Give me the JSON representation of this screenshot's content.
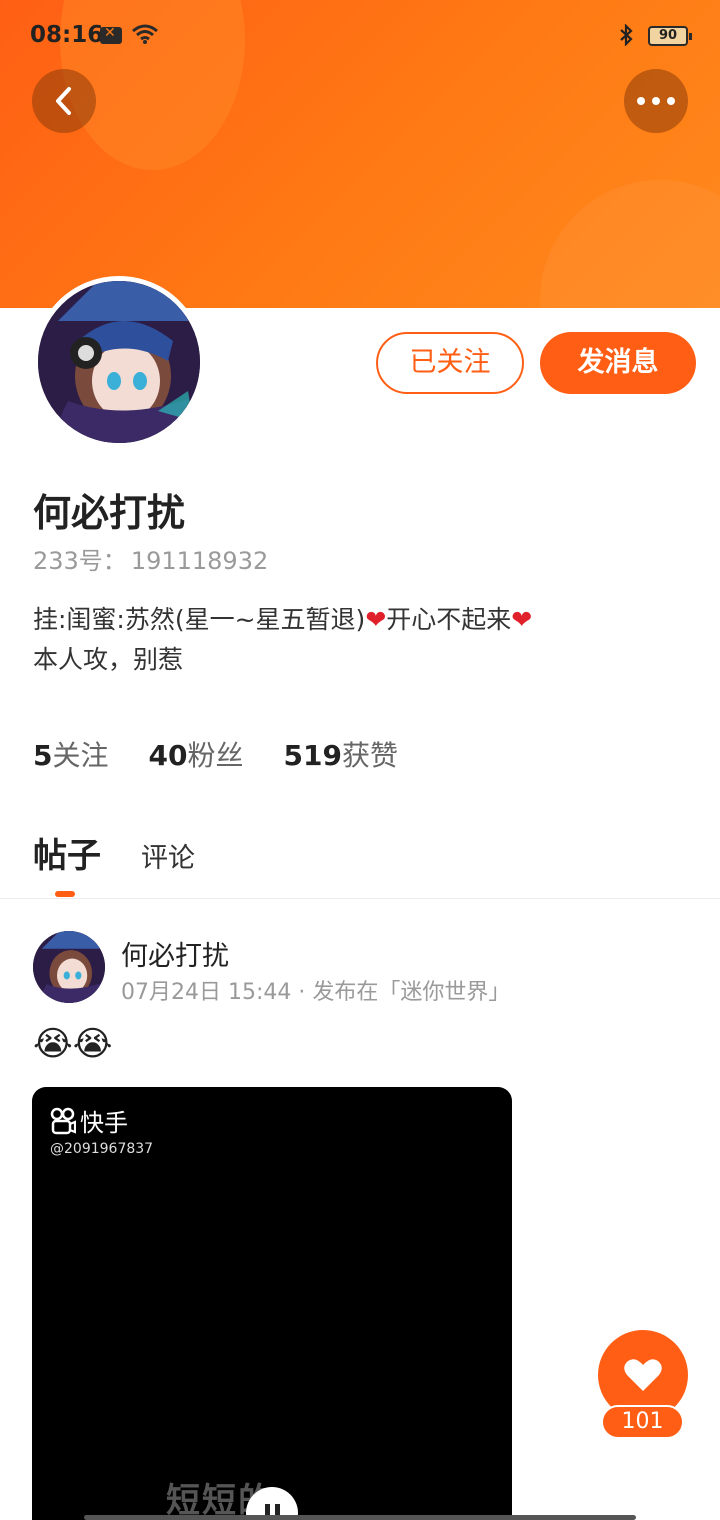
{
  "status_bar": {
    "time": "08:16",
    "battery": "90"
  },
  "header": {
    "gradient_start": "#ff5f14",
    "gradient_end": "#ff8a1e"
  },
  "profile": {
    "follow_button_label": "已关注",
    "message_button_label": "发消息",
    "name": "何必打扰",
    "id_label": "233号：",
    "id_value": "191118932",
    "bio_line1_prefix": "挂:闺蜜:苏然(星一~星五暂退)",
    "bio_heart": "❤",
    "bio_line1_suffix": "开心不起来",
    "bio_line2": "本人攻，别惹"
  },
  "stats": {
    "following_count": "5",
    "following_label": "关注",
    "fans_count": "40",
    "fans_label": "粉丝",
    "likes_count": "519",
    "likes_label": "获赞"
  },
  "tabs": {
    "posts": "帖子",
    "comments": "评论"
  },
  "post": {
    "author": "何必打扰",
    "meta": "07月24日 15:44 · 发布在「迷你世界」",
    "content": "😭😭",
    "video": {
      "brand": "快手",
      "account": "@2091967837",
      "caption": "短短的"
    }
  },
  "like_fab": {
    "count": "101"
  },
  "accent_color": "#ff5e14"
}
